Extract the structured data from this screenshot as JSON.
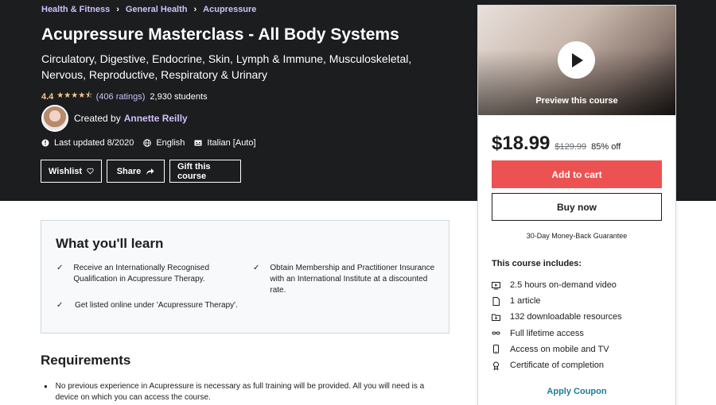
{
  "breadcrumb": [
    {
      "label": "Health & Fitness"
    },
    {
      "label": "General Health"
    },
    {
      "label": "Acupressure"
    }
  ],
  "course": {
    "title": "Acupressure Masterclass - All Body Systems",
    "subtitle": "Circulatory, Digestive, Endocrine, Skin, Lymph & Immune, Musculoskeletal, Nervous, Reproductive, Respiratory & Urinary",
    "rating": "4.4",
    "stars": "★★★★⯪",
    "ratings_count": "(406 ratings)",
    "students": "2,930 students",
    "created_by_label": "Created by",
    "creator": "Annette Reilly",
    "last_updated": "Last updated 8/2020",
    "language": "English",
    "captions": "Italian [Auto]"
  },
  "actions": {
    "wishlist": "Wishlist",
    "share": "Share",
    "gift": "Gift this course"
  },
  "sidebar": {
    "preview_label": "Preview this course",
    "price_current": "$18.99",
    "price_original": "$129.99",
    "discount": "85% off",
    "add_to_cart": "Add to cart",
    "buy_now": "Buy now",
    "guarantee": "30-Day Money-Back Guarantee",
    "includes_title": "This course includes:",
    "includes": [
      {
        "icon": "video-icon",
        "label": "2.5 hours on-demand video"
      },
      {
        "icon": "article-icon",
        "label": "1 article"
      },
      {
        "icon": "folder-icon",
        "label": "132 downloadable resources"
      },
      {
        "icon": "infinity-icon",
        "label": "Full lifetime access"
      },
      {
        "icon": "mobile-icon",
        "label": "Access on mobile and TV"
      },
      {
        "icon": "certificate-icon",
        "label": "Certificate of completion"
      }
    ],
    "apply_coupon": "Apply Coupon"
  },
  "learn": {
    "title": "What you'll learn",
    "items": [
      "Receive an Internationally Recognised Qualification in Acupressure Therapy.",
      "Obtain Membership and Practitioner Insurance with an International Institute at a discounted rate.",
      "Get listed online under 'Acupressure Therapy'."
    ]
  },
  "requirements": {
    "title": "Requirements",
    "items": [
      "No previous experience in Acupressure is necessary as full training will be provided. All you will need is a device on which you can access the course."
    ]
  },
  "colors": {
    "hero_bg": "#1c1d1f",
    "link_purple": "#cec0fc",
    "star": "#f3ca8c",
    "cart_red": "#ec5252",
    "coupon_blue": "#1f7a9c"
  }
}
